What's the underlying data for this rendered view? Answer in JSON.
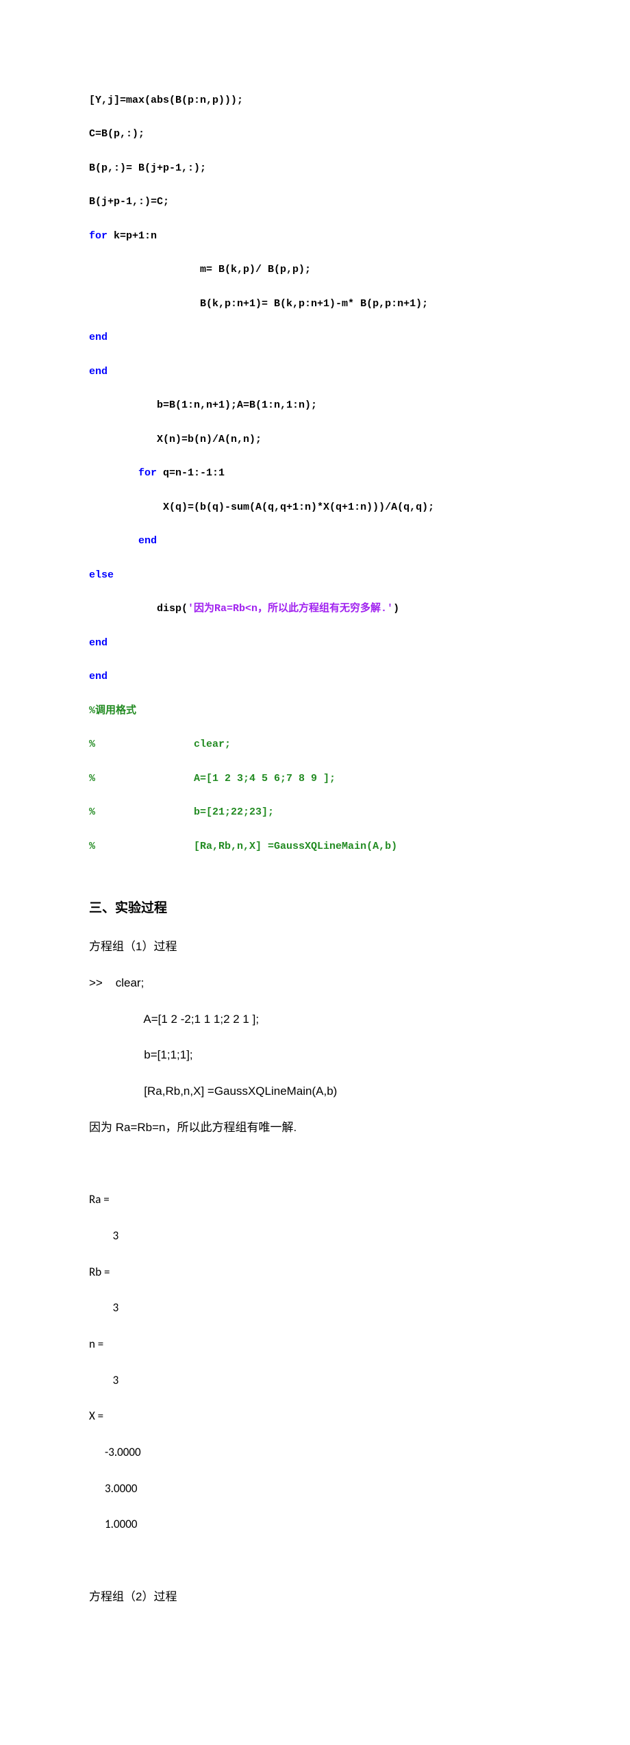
{
  "code": {
    "l1a": "[Y,j]=max(abs(B(p:n,p)));",
    "l2a": "C=B(p,:);",
    "l3a": "B(p,:)= B(j+p-1,:);",
    "l4a": "B(j+p-1,:)=C;",
    "l5_kw": "for",
    "l5_rest": " k=p+1:n",
    "l6a": "                  m= B(k,p)/ B(p,p);",
    "l7a": "                  B(k,p:n+1)= B(k,p:n+1)-m* B(p,p:n+1);",
    "l8_kw": "end",
    "l9_kw": "end",
    "l10a": "           b=B(1:n,n+1);A=B(1:n,1:n);",
    "l11a": "           X(n)=b(n)/A(n,n);",
    "l12_pre": "        ",
    "l12_kw": "for",
    "l12_rest": " q=n-1:-1:1",
    "l13a": "            X(q)=(b(q)-sum(A(q,q+1:n)*X(q+1:n)))/A(q,q);",
    "l14_pre": "        ",
    "l14_kw": "end",
    "l15_kw": "else",
    "l16_pre": "           disp(",
    "l16_str": "'因为Ra=Rb<n，所以此方程组有无穷多解.'",
    "l16_post": ")",
    "l17_kw": "end",
    "l18_kw": "end",
    "c1": "%调用格式",
    "c2": "%                clear;",
    "c3": "%                A=[1 2 3;4 5 6;7 8 9 ];",
    "c4": "%                b=[21;22;23];",
    "c5": "%                [Ra,Rb,n,X] =GaussXQLineMain(A,b)"
  },
  "heading": "三、实验过程",
  "proc": {
    "p1": "方程组（1）过程",
    "p2": ">>    clear;",
    "p3": "                 A=[1 2 -2;1 1 1;2 2 1 ];",
    "p4": "                 b=[1;1;1];",
    "p5": "                 [Ra,Rb,n,X] =GaussXQLineMain(A,b)",
    "p6": "因为 Ra=Rb=n，所以此方程组有唯一解.",
    "r1": "Ra =",
    "r1v": "         3",
    "r2": "Rb =",
    "r2v": "         3",
    "r3": "n =",
    "r3v": "         3",
    "r4": "X =",
    "r5": "      -3.0000",
    "r6": "      3.0000",
    "r7": "      1.0000",
    "p7": "方程组（2）过程"
  }
}
